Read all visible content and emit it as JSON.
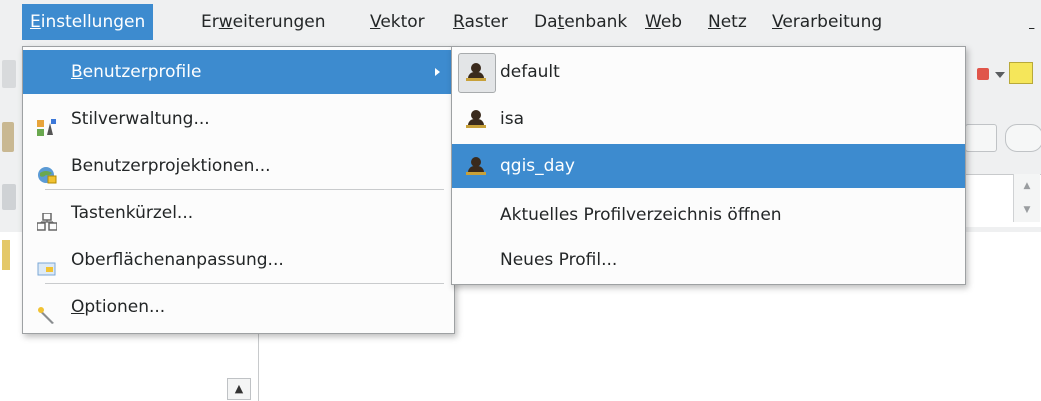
{
  "menubar": {
    "items": [
      {
        "label": "Einstellungen",
        "accel": "E",
        "rest": "instellungen"
      },
      {
        "label": "Erweiterungen",
        "pre": "Er",
        "accel": "w",
        "rest": "eiterungen"
      },
      {
        "label": "Vektor",
        "accel": "V",
        "rest": "ektor"
      },
      {
        "label": "Raster",
        "accel": "R",
        "rest": "aster"
      },
      {
        "label": "Datenbank",
        "pre": "Da",
        "accel": "t",
        "rest": "enbank"
      },
      {
        "label": "Web",
        "accel": "W",
        "rest": "eb"
      },
      {
        "label": "Netz",
        "accel": "N",
        "rest": "etz"
      },
      {
        "label": "Verarbeitung",
        "accel": "V",
        "rest": "erarbeitung"
      }
    ]
  },
  "settings_menu": {
    "items": [
      {
        "label": "Benutzerprofile",
        "accel": "B",
        "rest": "enutzerprofile",
        "icon": "none",
        "has_submenu": true
      },
      {
        "label": "Stilverwaltung...",
        "icon": "style-manager-icon"
      },
      {
        "label": "Benutzerprojektionen...",
        "icon": "projection-globe-icon"
      },
      {
        "label": "Tastenkürzel...",
        "icon": "keyboard-shortcuts-icon"
      },
      {
        "label": "Oberflächenanpassung...",
        "icon": "interface-customization-icon"
      },
      {
        "label": "Optionen...",
        "accel": "O",
        "rest": "ptionen...",
        "icon": "wrench-icon"
      }
    ]
  },
  "profiles_submenu": {
    "profiles": [
      {
        "label": "default",
        "icon": "user-profile-icon",
        "checked": true
      },
      {
        "label": "isa",
        "icon": "user-profile-icon"
      },
      {
        "label": "qgis_day",
        "icon": "user-profile-icon",
        "highlighted": true
      }
    ],
    "actions": [
      {
        "label": "Aktuelles Profilverzeichnis öffnen"
      },
      {
        "label": "Neues Profil..."
      }
    ]
  },
  "colors": {
    "highlight": "#3d8bcf",
    "menubar_bg": "#eff0f1",
    "menu_bg": "#fcfcfc"
  }
}
